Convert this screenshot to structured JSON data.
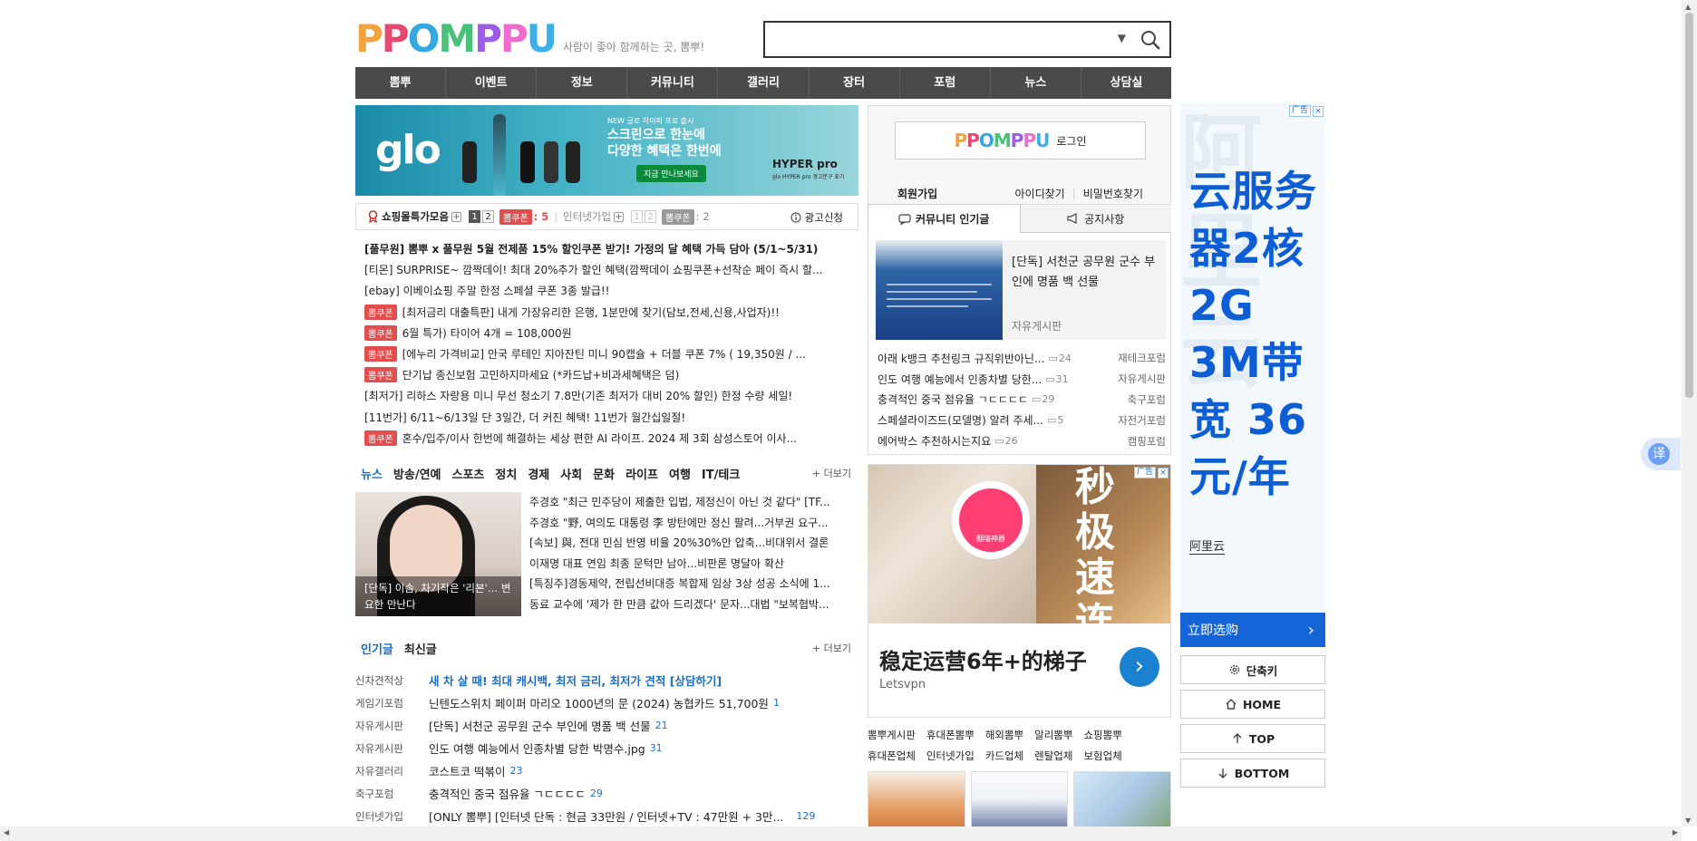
{
  "header": {
    "logo_text": "PPOMPPU",
    "tagline": "사람이 좋아 함께하는 곳, 뽐뿌!",
    "search_value": ""
  },
  "gnb": [
    "뽐뿌",
    "이벤트",
    "정보",
    "커뮤니티",
    "갤러리",
    "장터",
    "포럼",
    "뉴스",
    "상담실"
  ],
  "banner": {
    "brand": "glo",
    "small": "NEW 글로 하이퍼 프로 출시",
    "line1": "스크린으로 한눈에",
    "line2": "다양한 혜택은 한번에",
    "cta": "지금 만나보세요",
    "product": "HYPER pro",
    "product_sub": "glo HYPER pro 경고문구 표기"
  },
  "shopbar": {
    "title": "쇼핑몰특가모음",
    "plus": "+",
    "pages1": [
      "1",
      "2"
    ],
    "coupon_label": "뽐쿠폰",
    "coupon_count": ": 5",
    "internet": "인터넷가입",
    "pages2": [
      "1",
      "2"
    ],
    "coupon2_count": ": 2",
    "ad_apply": "광고신청"
  },
  "hot_posts": [
    {
      "badge": "",
      "text": "[풀무원] 뽐뿌 x 풀무원 5월 전제품 15% 할인쿠폰 받기! 가정의 달 혜택 가득 담아 (5/1~5/31)",
      "bold": true
    },
    {
      "badge": "",
      "text": "[티몬] SURPRISE~ 깜짝데이! 최대 20%추가 할인 혜택(깜짝데이 쇼핑쿠폰+선착순 페이 즉시 할..."
    },
    {
      "badge": "",
      "text": "[ebay] 이베이쇼핑 주말 한정 스페셜 쿠폰 3종 발급!!"
    },
    {
      "badge": "뽐쿠폰",
      "text": "[최저금리 대출특판] 내게 가장유리한 은행, 1분만에 찾기(담보,전세,신용,사업자)!!"
    },
    {
      "badge": "뽐쿠폰",
      "text": "6월 특가) 타이어 4개 = 108,000원"
    },
    {
      "badge": "뽐쿠폰",
      "text": "[에누리 가격비교] 안국 루테인 지아잔틴 미니 90캡슐 + 더블 쿠폰 7% ( 19,350원 / ..."
    },
    {
      "badge": "뽐쿠폰",
      "text": "단기납 종신보험 고민하지마세요 (*카드납+비과세혜택은 덤)"
    },
    {
      "badge": "",
      "text": "[최저가] 리하스 자랑용 미니 무선 청소기 7.8만(기존 최저가 대비 20% 할인) 한정 수량 세일!"
    },
    {
      "badge": "",
      "text": "[11번가] 6/11~6/13일 단 3일간, 더 커진 혜택! 11번가 월간십일절!"
    },
    {
      "badge": "뽐쿠폰",
      "text": "혼수/입주/이사 한번에 해결하는 세상 편한 AI 라이프. 2024 제 3회 삼성스토어 이사..."
    }
  ],
  "news": {
    "tabs": [
      "뉴스",
      "방송/연예",
      "스포츠",
      "정치",
      "경제",
      "사회",
      "문화",
      "라이프",
      "여행",
      "IT/테크"
    ],
    "more": "+ 더보기",
    "img_caption": "[단독] 이솜, 차기작은 '리본'… 변요한 만난다",
    "items": [
      "주경호 \"최근 민주당이 제출한 입법, 제정신이 아닌 것 같다\" [TF...",
      "주경호 \"野, 여의도 대통령 李 방탄에만 정신 팔려...거부권 요구...",
      "[속보] 與, 전대 민심 반영 비율 20%30%안 압축...비대위서 결론",
      "이재명 대표 연임 최종 문턱만 남아...비판론 명달아 확산",
      "[특징주]경동제약, 전립선비대증 복합제 임상 3상 성공 소식에 1...",
      "동료 교수에 '제가 한 만큼 값아 드리겠다' 문자...대법 \"보복협박..."
    ]
  },
  "popular": {
    "tabs": [
      "인기글",
      "최신글"
    ],
    "more": "+ 더보기",
    "items": [
      {
        "cat": "신차견적상",
        "text": "새 차 살 때! 최대 캐시백, 최저 금리, 최저가 견적 [상담하기]",
        "count": "",
        "ad": true
      },
      {
        "cat": "게임기포럼",
        "text": "닌텐도스위치 페이퍼 마리오 1000년의 문 (2024) 농협카드 51,700원",
        "count": "1"
      },
      {
        "cat": "자유게시판",
        "text": "[단독] 서천군 공무원 군수 부인에 명품 백 선물",
        "count": "21"
      },
      {
        "cat": "자유게시판",
        "text": "인도 여행 예능에서 인종차별 당한 박명수.jpg",
        "count": "31"
      },
      {
        "cat": "자유갤러리",
        "text": "코스트코 떡볶이",
        "count": "23"
      },
      {
        "cat": "축구포럼",
        "text": "충격적인 중국 점유율 ㄱㄷㄷㄷㄷ",
        "count": "29"
      },
      {
        "cat": "인터넷가입",
        "text": "[ONLY 뽐뿌] [인터넷 단독 : 현금 33만원 / 인터넷+TV : 47만원 + 3만...",
        "count": "129"
      }
    ]
  },
  "login": {
    "logo_text": "PPOMPPU",
    "login_label": "로그인",
    "join": "회원가입",
    "find_id": "아이디찾기",
    "find_pw": "비밀번호찾기",
    "sep": "|"
  },
  "community_tabs": [
    "커뮤니티 인기글",
    "공지사항"
  ],
  "featured": {
    "title": "[단독] 서천군 공무원 군수 부인에 명품 백 선물",
    "board": "자유게시판"
  },
  "community_list": [
    {
      "text": "아래 k뱅크 추천링크 규직위반아닌...",
      "comments": "24",
      "board": "재테크포럼"
    },
    {
      "text": "인도 여행 예능에서 인종차별 당한...",
      "comments": "31",
      "board": "자유게시판"
    },
    {
      "text": "충격적인 중국 점유율 ㄱㄷㄷㄷㄷ",
      "comments": "29",
      "board": "축구포럼"
    },
    {
      "text": "스페셜라이즈드(모델명) 알려 주세...",
      "comments": "5",
      "board": "자전거포럼"
    },
    {
      "text": "에어박스 추천하시는지요",
      "comments": "26",
      "board": "캠핑포럼"
    }
  ],
  "ad_mid": {
    "tag": "广告",
    "vertical": "秒极速连线",
    "ring": "翻墙神器",
    "headline": "稳定运营6年+的梯子",
    "sub": "Letsvpn",
    "go": "›"
  },
  "site_links": [
    [
      "뽐뿌게시판",
      "휴대폰뽐뿌",
      "해외뽐뿌",
      "알리뽐뿌",
      "쇼핑뽐뿌"
    ],
    [
      "휴대폰업체",
      "인터넷가입",
      "카드업체",
      "렌탈업체",
      "보험업체"
    ]
  ],
  "ad_right": {
    "tag": "广告",
    "text": "云服务器2核2G 3M带宽 36元/年",
    "watermark": "阿里云",
    "brand": "阿里云",
    "buy": "立即选购",
    "chev": "›"
  },
  "side_buttons": [
    "단축키",
    "HOME",
    "TOP",
    "BOTTOM"
  ],
  "translate_label": "译",
  "colors": {
    "nav_bg": "#4a4a4a",
    "accent_blue": "#1a6fc4",
    "coupon_red": "#e34d4d",
    "aliyun_blue": "#1565d8"
  }
}
